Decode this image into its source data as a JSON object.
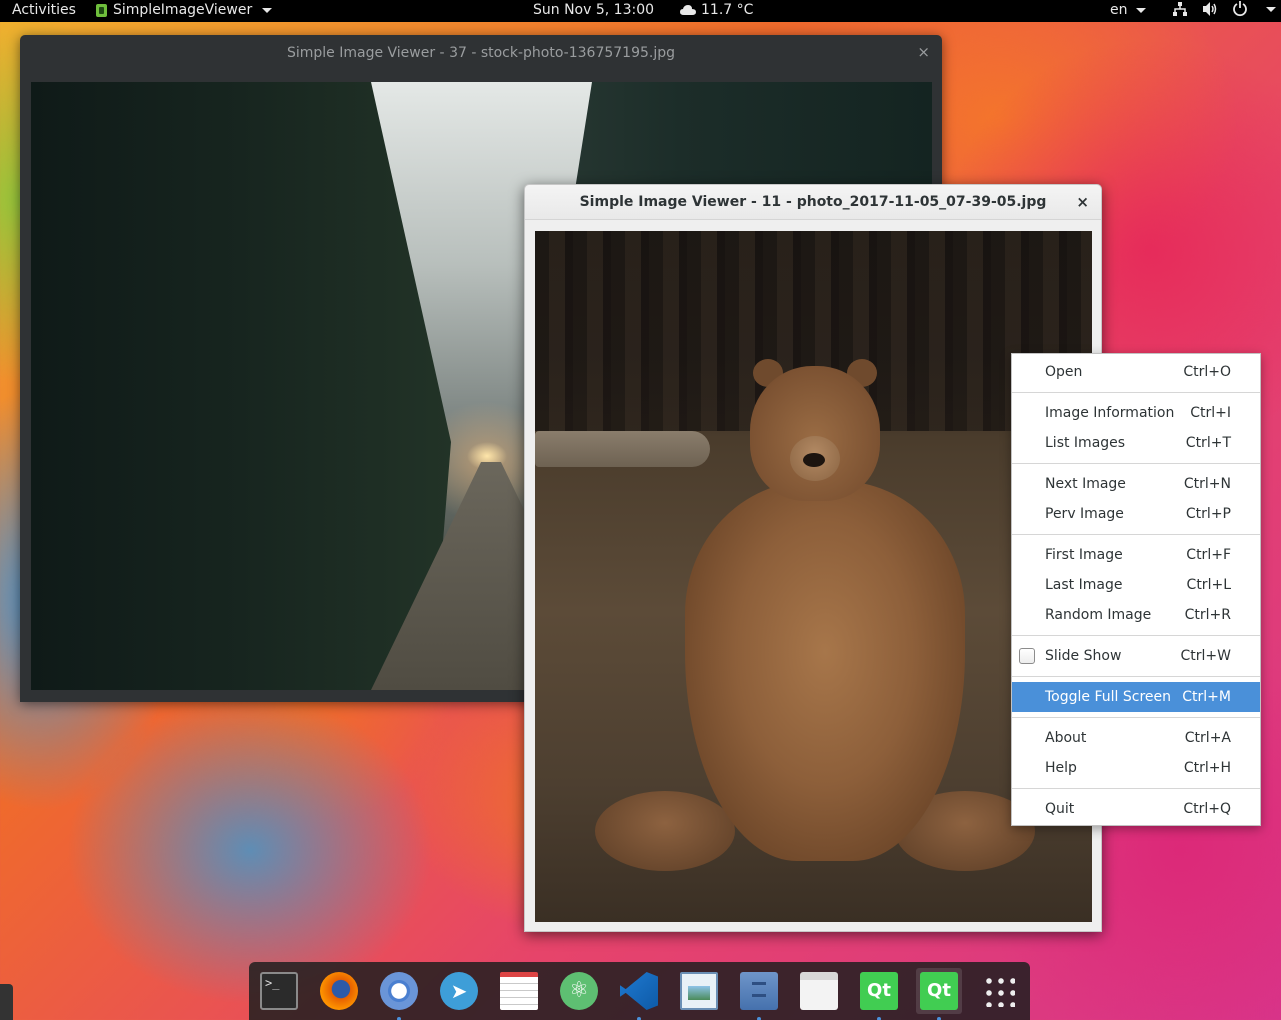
{
  "topbar": {
    "activities": "Activities",
    "app_name": "SimpleImageViewer",
    "clock": "Sun Nov  5, 13:00",
    "weather": "11.7 °C",
    "language": "en",
    "network_icon": "network-icon",
    "volume_icon": "volume-icon",
    "power_icon": "power-icon"
  },
  "windows": [
    {
      "title": "Simple Image Viewer - 37 - stock-photo-136757195.jpg",
      "close": "×",
      "focused": false
    },
    {
      "title": "Simple Image Viewer - 11 - photo_2017-11-05_07-39-05.jpg",
      "close": "×",
      "focused": true
    }
  ],
  "menu": {
    "items": [
      {
        "label": "Open",
        "shortcut": "Ctrl+O"
      },
      {
        "label": "Image Information",
        "shortcut": "Ctrl+I"
      },
      {
        "label": "List Images",
        "shortcut": "Ctrl+T"
      },
      {
        "label": "Next Image",
        "shortcut": "Ctrl+N"
      },
      {
        "label": "Perv Image",
        "shortcut": "Ctrl+P"
      },
      {
        "label": "First Image",
        "shortcut": "Ctrl+F"
      },
      {
        "label": "Last Image",
        "shortcut": "Ctrl+L"
      },
      {
        "label": "Random Image",
        "shortcut": "Ctrl+R"
      },
      {
        "label": "Slide Show",
        "shortcut": "Ctrl+W",
        "checkbox": true,
        "checked": false
      },
      {
        "label": "Toggle Full Screen",
        "shortcut": "Ctrl+M",
        "highlighted": true
      },
      {
        "label": "About",
        "shortcut": "Ctrl+A"
      },
      {
        "label": "Help",
        "shortcut": "Ctrl+H"
      },
      {
        "label": "Quit",
        "shortcut": "Ctrl+Q"
      }
    ]
  },
  "dock": {
    "items": [
      {
        "name": "terminal-icon",
        "glyph": ">_",
        "running": false
      },
      {
        "name": "firefox-icon",
        "running": false
      },
      {
        "name": "chromium-icon",
        "running": true
      },
      {
        "name": "telegram-icon",
        "glyph": "➤",
        "running": false
      },
      {
        "name": "text-editor-icon",
        "running": false
      },
      {
        "name": "atom-icon",
        "glyph": "⚛",
        "running": false
      },
      {
        "name": "vscode-icon",
        "running": true
      },
      {
        "name": "image-viewer-icon",
        "running": false
      },
      {
        "name": "file-manager-icon",
        "running": true
      },
      {
        "name": "software-center-icon",
        "running": false
      },
      {
        "name": "qt-creator-icon",
        "glyph": "Qt",
        "running": true
      },
      {
        "name": "qt-app-icon",
        "glyph": "Qt",
        "running": true
      },
      {
        "name": "app-grid-icon",
        "running": false
      }
    ]
  },
  "colors": {
    "menu_highlight": "#4a90d9",
    "topbar_bg": "#000000",
    "dock_running_dot": "#4a90d9"
  }
}
